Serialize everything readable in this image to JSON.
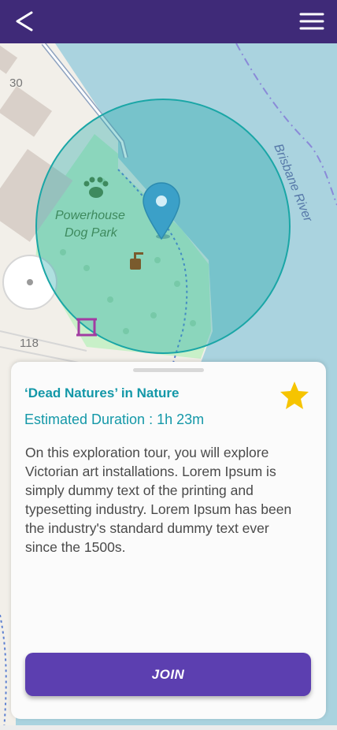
{
  "header": {
    "back_icon": "chevron-left-icon",
    "menu_icon": "hamburger-menu-icon",
    "background": "#3f2a78"
  },
  "map": {
    "labels": {
      "house_number_1": "30",
      "house_number_2": "118",
      "park_line1": "Powerhouse",
      "park_line2": "Dog Park",
      "river": "Brisbane River"
    },
    "icons": [
      "paw-icon",
      "location-pin-icon",
      "drinking-fountain-icon",
      "picnic-bench-icon"
    ],
    "geofence_color": "#1aa6a6",
    "park_color": "#c8f0c8",
    "water_color": "#aad3df"
  },
  "tour_card": {
    "title": "‘Dead Natures’ in Nature",
    "duration": "Estimated Duration : 1h 23m",
    "description": "On this exploration tour, you will explore Victorian art installations. Lorem Ipsum is simply dummy text of the printing and typesetting industry. Lorem Ipsum has been the industry's standard dummy text ever since the 1500s.",
    "favorite_icon": "star-icon",
    "favorite_color": "#f6c400",
    "join_label": "JOIN",
    "accent": "#1498a8",
    "button_color": "#5c3fb0"
  }
}
